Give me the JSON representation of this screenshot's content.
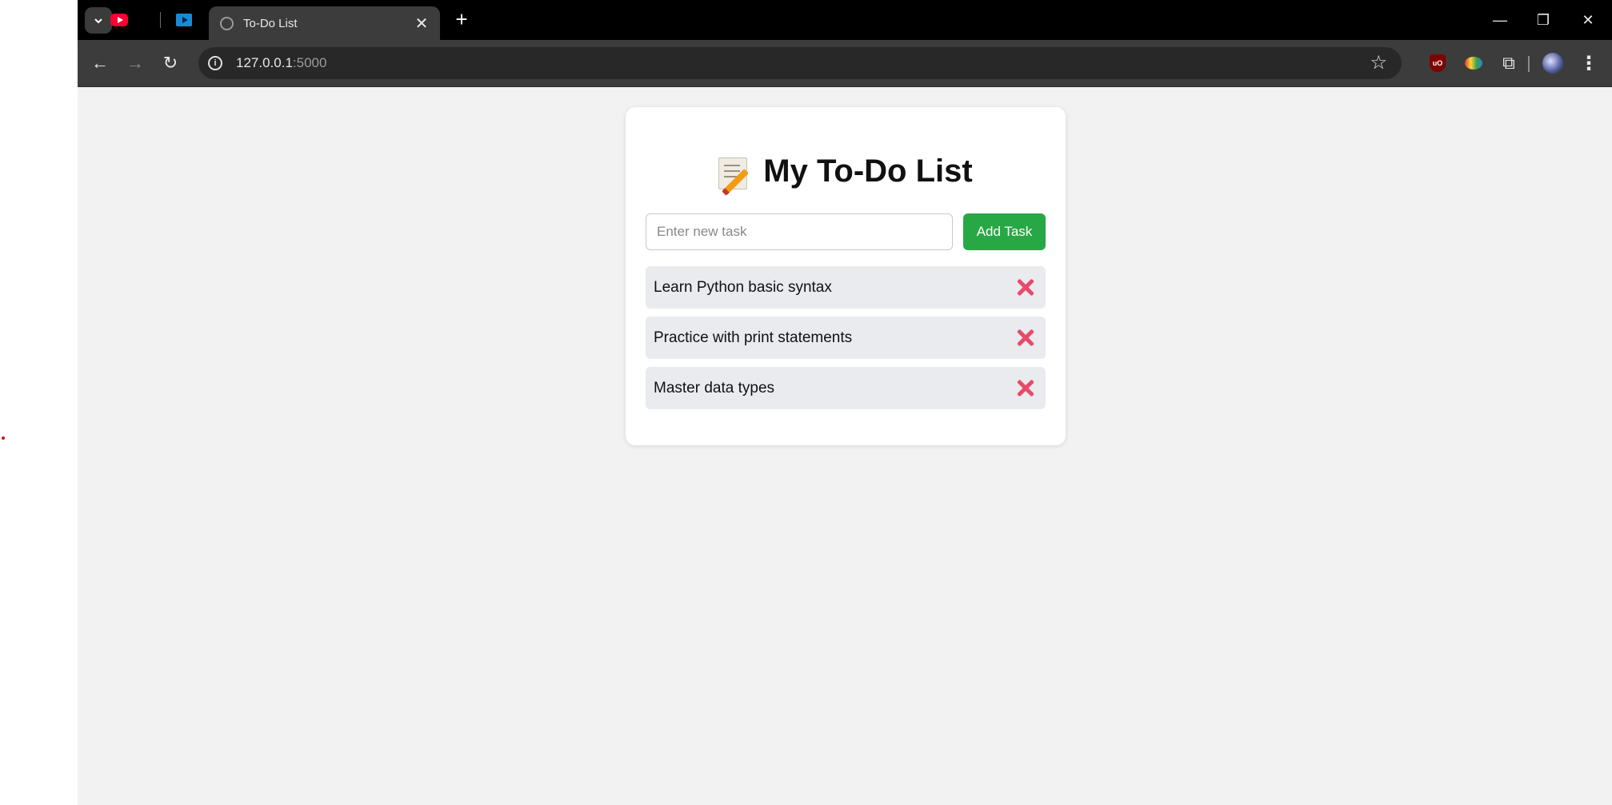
{
  "browser": {
    "tabs": {
      "active_title": "To-Do List"
    },
    "address_bar": {
      "host": "127.0.0.1",
      "port": ":5000"
    },
    "icons": {
      "tab_search": "chevron-down-icon",
      "new_tab": "plus-icon",
      "back": "arrow-left-icon",
      "forward": "arrow-right-icon",
      "reload": "reload-icon",
      "site_info": "info-icon",
      "bookmark": "star-icon",
      "extensions": "puzzle-icon",
      "menu": "kebab-icon",
      "ublock_label": "uO"
    }
  },
  "app": {
    "title": "My To-Do List",
    "input_placeholder": "Enter new task",
    "add_button": "Add Task",
    "tasks": [
      {
        "label": "Learn Python basic syntax"
      },
      {
        "label": "Practice with print statements"
      },
      {
        "label": "Master data types"
      }
    ],
    "colors": {
      "accent": "#28a745",
      "delete": "#e84a6a",
      "task_bg": "#e9ebee",
      "page_bg": "#f2f2f2"
    }
  }
}
